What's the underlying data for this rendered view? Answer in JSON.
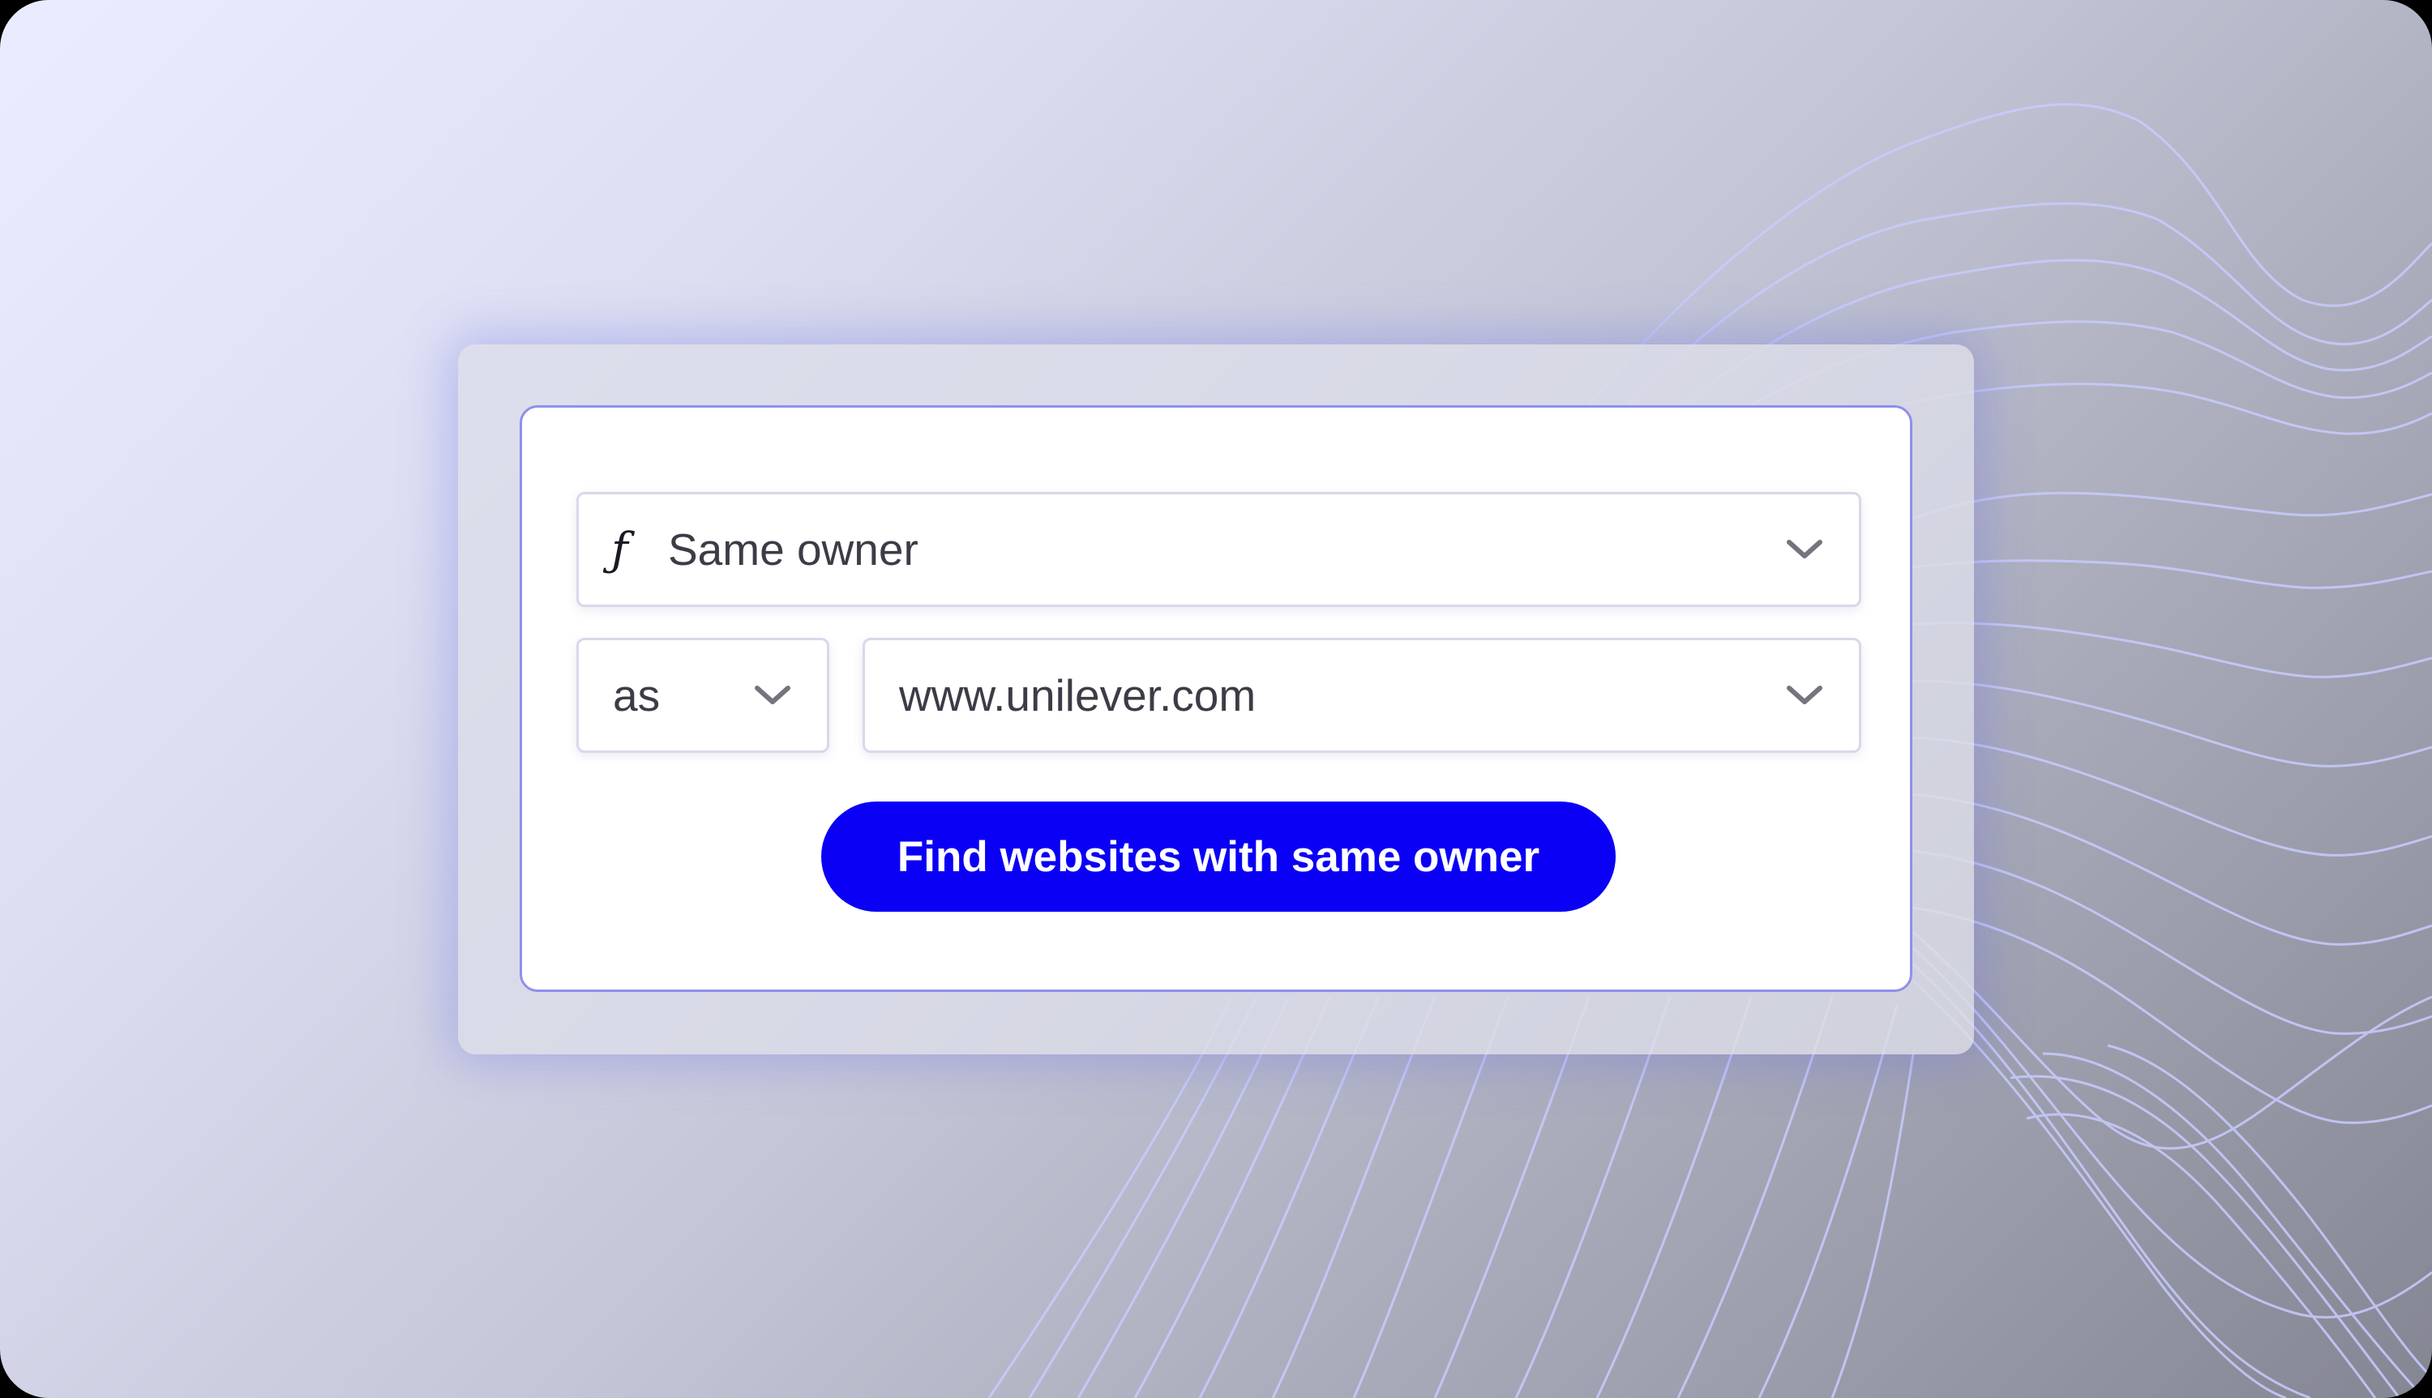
{
  "colors": {
    "accent": "#0a00f5",
    "card_border": "#8f8ff0",
    "wave_line": "#c8ccff"
  },
  "icons": {
    "function": "function-f-icon",
    "dropdown": "chevron-down-icon"
  },
  "form": {
    "function_select": {
      "icon_glyph": "ƒ",
      "value": "Same owner"
    },
    "relation_select": {
      "value": "as"
    },
    "domain_select": {
      "value": "www.unilever.com"
    },
    "submit_label": "Find websites with same owner"
  }
}
